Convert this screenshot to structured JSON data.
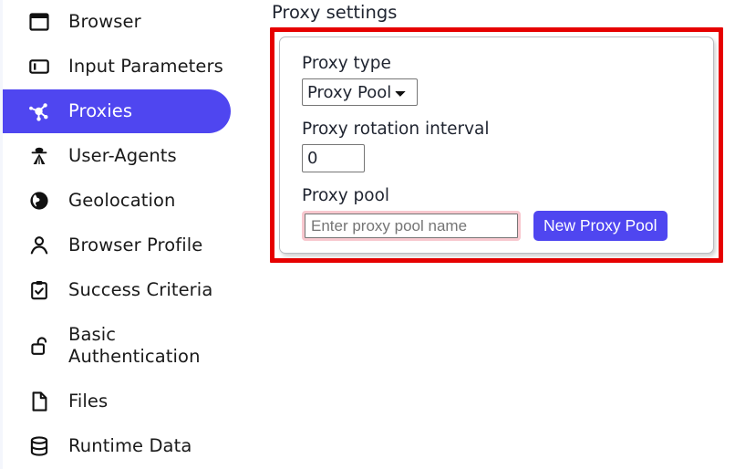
{
  "sidebar": {
    "items": [
      {
        "id": "browser",
        "label": "Browser",
        "icon": "browser-window-icon",
        "active": false
      },
      {
        "id": "input-params",
        "label": "Input Parameters",
        "icon": "input-field-icon",
        "active": false
      },
      {
        "id": "proxies",
        "label": "Proxies",
        "icon": "network-nodes-icon",
        "active": true
      },
      {
        "id": "user-agents",
        "label": "User-Agents",
        "icon": "spy-agent-icon",
        "active": false
      },
      {
        "id": "geolocation",
        "label": "Geolocation",
        "icon": "globe-icon",
        "active": false
      },
      {
        "id": "browser-profile",
        "label": "Browser Profile",
        "icon": "person-icon",
        "active": false
      },
      {
        "id": "success-criteria",
        "label": "Success Criteria",
        "icon": "clipboard-check-icon",
        "active": false
      },
      {
        "id": "basic-auth",
        "label": "Basic\nAuthentication",
        "icon": "unlocked-padlock-icon",
        "active": false
      },
      {
        "id": "files",
        "label": "Files",
        "icon": "document-icon",
        "active": false
      },
      {
        "id": "runtime-data",
        "label": "Runtime Data",
        "icon": "database-icon",
        "active": false
      }
    ]
  },
  "main": {
    "title": "Proxy settings",
    "proxy_type": {
      "label": "Proxy type",
      "selected": "Proxy Pool",
      "options": [
        "Proxy Pool"
      ]
    },
    "rotation_interval": {
      "label": "Proxy rotation interval",
      "value": "0"
    },
    "proxy_pool": {
      "label": "Proxy pool",
      "value": "",
      "placeholder": "Enter proxy pool name",
      "button_label": "New Proxy Pool"
    }
  },
  "colors": {
    "accent": "#4f46f0",
    "highlight_annotation": "#e60000",
    "input_focus_ring": "#f8c8cf",
    "text": "#1f2430"
  }
}
